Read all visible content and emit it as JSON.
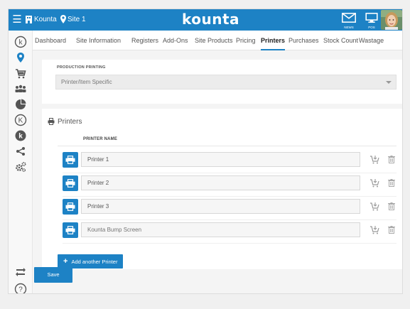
{
  "header": {
    "brand_label": "Kounta",
    "site_label": "Site 1",
    "logo_text": "kounta",
    "news_label": "NEWS",
    "pos_label": "POS"
  },
  "tabs": [
    {
      "label": "Dashboard"
    },
    {
      "label": "Site Information"
    },
    {
      "label": "Registers"
    },
    {
      "label": "Add-Ons"
    },
    {
      "label": "Site Products"
    },
    {
      "label": "Pricing"
    },
    {
      "label": "Printers",
      "active": true
    },
    {
      "label": "Purchases"
    },
    {
      "label": "Stock Count"
    },
    {
      "label": "Wastage"
    }
  ],
  "production_printing": {
    "label": "PRODUCTION PRINTING",
    "selected_value": "Printer/Item Specific"
  },
  "printers": {
    "heading": "Printers",
    "column_header": "PRINTER NAME",
    "rows": [
      {
        "value": "Printer 1",
        "placeholder": ""
      },
      {
        "value": "Printer 2",
        "placeholder": ""
      },
      {
        "value": "Printer 3",
        "placeholder": ""
      },
      {
        "value": "",
        "placeholder": "Kounta Bump Screen"
      }
    ],
    "add_button_label": "Add another Printer"
  },
  "save_button_label": "Save",
  "colors": {
    "accent": "#1d82c5",
    "background": "#f4f4f4",
    "panel": "#ffffff"
  },
  "icons": {
    "menu": "hamburger-icon",
    "store": "store-icon",
    "location": "location-pin-icon",
    "news": "envelope-icon",
    "pos": "monitor-icon",
    "sidebar": [
      "kounta-circle-icon",
      "location-pin-icon",
      "cart-icon",
      "people-icon",
      "pie-chart-icon",
      "kounta-circle-outline-icon",
      "kounta-circle-filled-icon",
      "share-icon",
      "gears-icon",
      "sync-icon",
      "help-icon"
    ],
    "row_actions": [
      "printer-icon",
      "cart-assign-icon",
      "trash-icon"
    ]
  }
}
